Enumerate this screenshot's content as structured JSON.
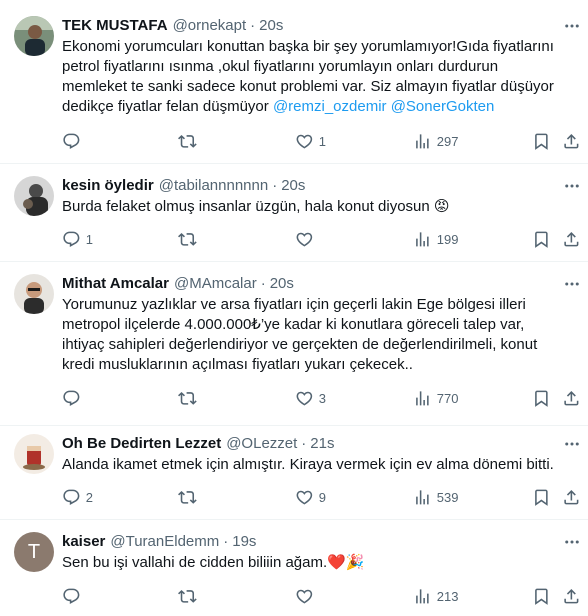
{
  "tweets": [
    {
      "name": "TEK MUSTAFA",
      "handle": "@ornekapt",
      "dot": "·",
      "time": "20s",
      "lines": [
        "Ekonomi yorumcuları konuttan başka bir şey yorumlamıyor!Gıda fiyatlarını",
        "petrol fiyatlarını ısınma ,okul fiyatlarını yorumlayın onları durdurun",
        "memleket te sanki sadece konut  problemi var. Siz almayın fiyatlar düşüyor",
        "dedikçe fiyatlar felan düşmüyor "
      ],
      "mention1": "@remzi_ozdemir",
      "mention2": "@SonerGokten",
      "replies": "",
      "retweets": "",
      "likes": "1",
      "views": "297"
    },
    {
      "name": "kesin öyledir",
      "handle": "@tabilannnnnnn",
      "dot": "·",
      "time": "20s",
      "lines": [
        "Burda felaket olmuş insanlar üzgün, hala konut diyosun 😡"
      ],
      "replies": "1",
      "retweets": "",
      "likes": "",
      "views": "199"
    },
    {
      "name": "Mithat Amcalar",
      "handle": "@MAmcalar",
      "dot": "·",
      "time": "20s",
      "lines": [
        "Yorumunuz yazlıklar ve arsa fiyatları için geçerli lakin Ege bölgesi illeri",
        "metropol ilçelerde 4.000.000₺’ye kadar ki konutlara göreceli talep var,",
        "ihtiyaç sahipleri değerlendiriyor ve gerçekten de değerlendirilmeli, konut",
        "kredi musluklarının açılması fiyatları yukarı çekecek.."
      ],
      "replies": "",
      "retweets": "",
      "likes": "3",
      "views": "770"
    },
    {
      "name": "Oh Be Dedirten Lezzet",
      "handle": "@OLezzet",
      "dot": "·",
      "time": "21s",
      "lines": [
        "Alanda ikamet etmek için almıştır. Kiraya vermek için ev alma dönemi bitti."
      ],
      "replies": "2",
      "retweets": "",
      "likes": "9",
      "views": "539"
    },
    {
      "name": "kaiser",
      "handle": "@TuranEldemm",
      "dot": "·",
      "time": "19s",
      "avatar_letter": "T",
      "lines": [
        "Sen bu işi vallahi de cidden biliiin ağam.❤️🎉"
      ],
      "replies": "",
      "retweets": "",
      "likes": "",
      "views": "213"
    }
  ],
  "colors": {
    "text": "#0f1419",
    "secondary": "#536471",
    "link": "#1d9bf0",
    "divider": "#eff3f4"
  },
  "icons": [
    "reply-icon",
    "retweet-icon",
    "like-icon",
    "views-icon",
    "bookmark-icon",
    "share-icon",
    "more-icon"
  ]
}
